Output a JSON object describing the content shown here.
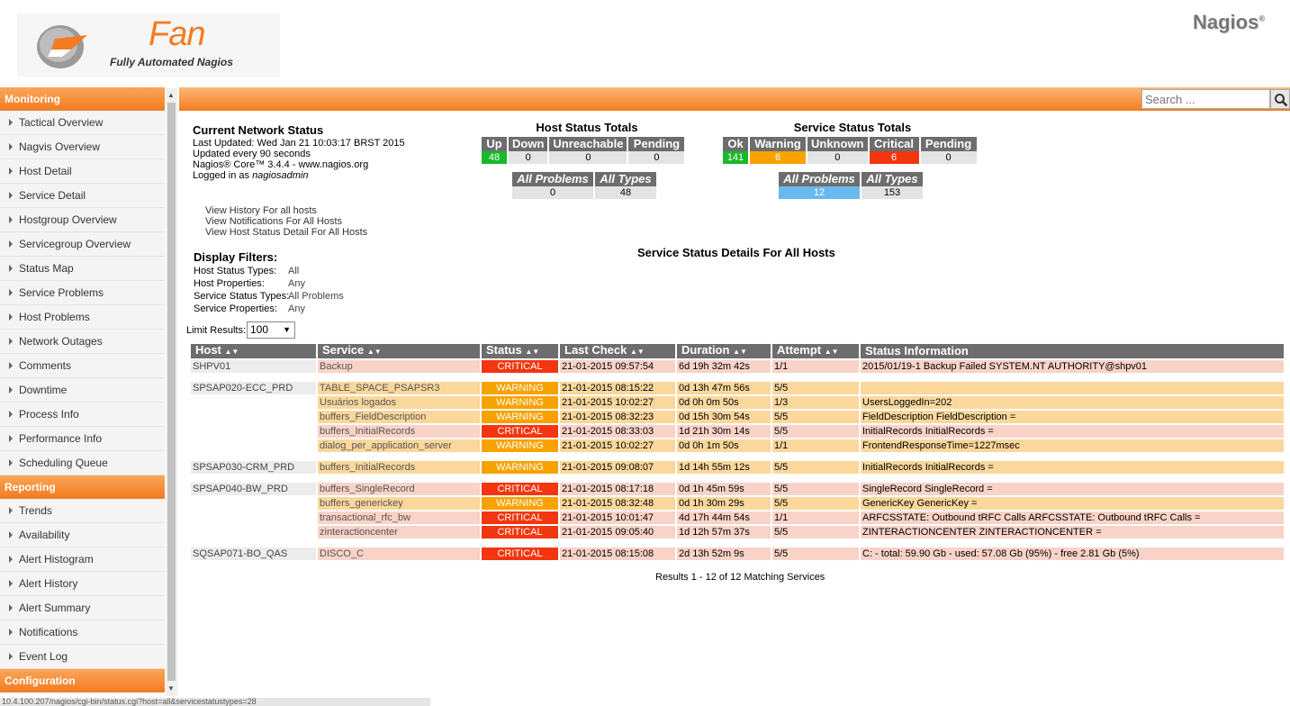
{
  "logo": {
    "brand": "Fan",
    "subtitle": "Fully Automated Nagios",
    "nagios": "Nagios",
    "nagios_mark": "®"
  },
  "search": {
    "placeholder": "Search ..."
  },
  "sidebar": {
    "sections": [
      {
        "title": "Monitoring",
        "items": [
          "Tactical Overview",
          "Nagvis Overview",
          "Host Detail",
          "Service Detail",
          "Hostgroup Overview",
          "Servicegroup Overview",
          "Status Map",
          "Service Problems",
          "Host Problems",
          "Network Outages",
          "Comments",
          "Downtime",
          "Process Info",
          "Performance Info",
          "Scheduling Queue"
        ]
      },
      {
        "title": "Reporting",
        "items": [
          "Trends",
          "Availability",
          "Alert Histogram",
          "Alert History",
          "Alert Summary",
          "Notifications",
          "Event Log"
        ]
      },
      {
        "title": "Configuration",
        "items": []
      }
    ]
  },
  "status": {
    "title": "Current Network Status",
    "last_updated": "Last Updated: Wed Jan 21 10:03:17 BRST 2015",
    "update_every": "Updated every 90 seconds",
    "version": "Nagios® Core™ 3.4.4 - www.nagios.org",
    "logged_in_prefix": "Logged in as ",
    "logged_in_user": "nagiosadmin",
    "links": [
      "View History For all hosts",
      "View Notifications For All Hosts",
      "View Host Status Detail For All Hosts"
    ]
  },
  "host_totals": {
    "title": "Host Status Totals",
    "headers": [
      "Up",
      "Down",
      "Unreachable",
      "Pending"
    ],
    "values": [
      "48",
      "0",
      "0",
      "0"
    ],
    "sum_headers": [
      "All Problems",
      "All Types"
    ],
    "sum_values": [
      "0",
      "48"
    ]
  },
  "service_totals": {
    "title": "Service Status Totals",
    "headers": [
      "Ok",
      "Warning",
      "Unknown",
      "Critical",
      "Pending"
    ],
    "values": [
      "141",
      "6",
      "0",
      "6",
      "0"
    ],
    "sum_headers": [
      "All Problems",
      "All Types"
    ],
    "sum_values": [
      "12",
      "153"
    ]
  },
  "colors": {
    "up": "#18b82a",
    "ok": "#18b82a",
    "warning": "#f8a200",
    "critical": "#f3360f",
    "problems": "#69b8ee",
    "accent": "#f47c20"
  },
  "filters": {
    "title": "Display Filters:",
    "rows": [
      {
        "label": "Host Status Types:",
        "value": "All"
      },
      {
        "label": "Host Properties:",
        "value": "Any"
      },
      {
        "label": "Service Status Types:",
        "value": "All Problems"
      },
      {
        "label": "Service Properties:",
        "value": "Any"
      }
    ]
  },
  "details_title": "Service Status Details For All Hosts",
  "limit": {
    "label": "Limit Results:",
    "value": "100"
  },
  "table": {
    "headers": [
      "Host",
      "Service",
      "Status",
      "Last Check",
      "Duration",
      "Attempt",
      "Status Information"
    ],
    "rows": [
      {
        "host": "SHPV01",
        "service": "Backup",
        "status": "CRITICAL",
        "last_check": "21-01-2015 09:57:54",
        "duration": "6d 19h 32m 42s",
        "attempt": "1/1",
        "info": "2015/01/19-1 Backup Failed SYSTEM.NT AUTHORITY@shpv01",
        "gap_after": true
      },
      {
        "host": "SPSAP020-ECC_PRD",
        "service": "TABLE_SPACE_PSAPSR3",
        "status": "WARNING",
        "last_check": "21-01-2015 08:15:22",
        "duration": "0d 13h 47m 56s",
        "attempt": "5/5",
        "info": ""
      },
      {
        "host": "",
        "service": "Usuários logados",
        "status": "WARNING",
        "last_check": "21-01-2015 10:02:27",
        "duration": "0d 0h 0m 50s",
        "attempt": "1/3",
        "info": "UsersLoggedIn=202"
      },
      {
        "host": "",
        "service": "buffers_FieldDescription",
        "status": "WARNING",
        "last_check": "21-01-2015 08:32:23",
        "duration": "0d 15h 30m 54s",
        "attempt": "5/5",
        "info": "FieldDescription FieldDescription ="
      },
      {
        "host": "",
        "service": "buffers_InitialRecords",
        "status": "CRITICAL",
        "last_check": "21-01-2015 08:33:03",
        "duration": "1d 21h 30m 14s",
        "attempt": "5/5",
        "info": "InitialRecords InitialRecords ="
      },
      {
        "host": "",
        "service": "dialog_per_application_server",
        "status": "WARNING",
        "last_check": "21-01-2015 10:02:27",
        "duration": "0d 0h 1m 50s",
        "attempt": "1/1",
        "info": "FrontendResponseTime=1227msec",
        "gap_after": true
      },
      {
        "host": "SPSAP030-CRM_PRD",
        "service": "buffers_InitialRecords",
        "status": "WARNING",
        "last_check": "21-01-2015 09:08:07",
        "duration": "1d 14h 55m 12s",
        "attempt": "5/5",
        "info": "InitialRecords InitialRecords =",
        "gap_after": true
      },
      {
        "host": "SPSAP040-BW_PRD",
        "service": "buffers_SingleRecord",
        "status": "CRITICAL",
        "last_check": "21-01-2015 08:17:18",
        "duration": "0d 1h 45m 59s",
        "attempt": "5/5",
        "info": "SingleRecord SingleRecord ="
      },
      {
        "host": "",
        "service": "buffers_generickey",
        "status": "WARNING",
        "last_check": "21-01-2015 08:32:48",
        "duration": "0d 1h 30m 29s",
        "attempt": "5/5",
        "info": "GenericKey GenericKey ="
      },
      {
        "host": "",
        "service": "transactional_rfc_bw",
        "status": "CRITICAL",
        "last_check": "21-01-2015 10:01:47",
        "duration": "4d 17h 44m 54s",
        "attempt": "1/1",
        "info": "ARFCSSTATE: Outbound tRFC Calls ARFCSSTATE: Outbound tRFC Calls ="
      },
      {
        "host": "",
        "service": "zinteractioncenter",
        "status": "CRITICAL",
        "last_check": "21-01-2015 09:05:40",
        "duration": "1d 12h 57m 37s",
        "attempt": "5/5",
        "info": "ZINTERACTIONCENTER ZINTERACTIONCENTER =",
        "gap_after": true
      },
      {
        "host": "SQSAP071-BO_QAS",
        "service": "DISCO_C",
        "status": "CRITICAL",
        "last_check": "21-01-2015 08:15:08",
        "duration": "2d 13h 52m 9s",
        "attempt": "5/5",
        "info": "C: - total: 59.90 Gb - used: 57.08 Gb (95%) - free 2.81 Gb (5%)"
      }
    ]
  },
  "results_text": "Results 1 - 12 of 12 Matching Services",
  "status_bar_url": "10.4.100.207/nagios/cgi-bin/status.cgi?host=all&servicestatustypes=28"
}
